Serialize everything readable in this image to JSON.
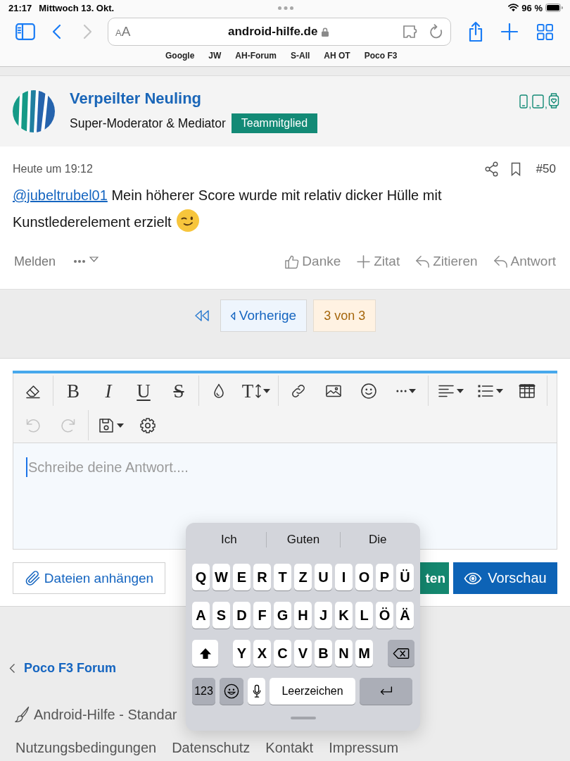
{
  "status_bar": {
    "time": "21:17",
    "date": "Mittwoch 13. Okt.",
    "battery": "96 %"
  },
  "browser": {
    "nav": [
      {
        "kind": "back",
        "disabled": false
      },
      {
        "kind": "forward",
        "disabled": true
      }
    ],
    "text_size": [
      "A",
      "A"
    ],
    "url": "android-hilfe.de",
    "bookmarks": [
      "Google",
      "JW",
      "AH-Forum",
      "S-All",
      "AH OT",
      "Poco F3"
    ]
  },
  "user": {
    "name": "Verpeilter Neuling",
    "role": "Super-Moderator & Mediator",
    "badge": "Teammitglied",
    "devices": [
      {
        "kind": "phone",
        "separator": ","
      },
      {
        "kind": "tablet",
        "separator": ","
      },
      {
        "kind": "watch"
      }
    ]
  },
  "post": {
    "time": "Heute um 19:12",
    "number": "#50",
    "mention": "@jubeltrubel01",
    "message": "Mein höherer Score wurde mit relativ dicker Hülle mit Kunstlederelement erzielt",
    "report": "Melden",
    "actions": [
      {
        "kind": "like",
        "label": "Danke"
      },
      {
        "kind": "add",
        "label": "Zitat"
      },
      {
        "kind": "reply",
        "label": "Zitieren"
      },
      {
        "kind": "reply",
        "label": "Antwort"
      }
    ]
  },
  "pagination": {
    "previous": "Vorherige",
    "current": "3 von 3"
  },
  "editor": {
    "toolbar": [
      [
        [
          {
            "kind": "eraser",
            "dropdown": false,
            "disabled": false
          }
        ],
        [
          {
            "kind": "bold",
            "glyph": "B",
            "dropdown": false,
            "disabled": false
          },
          {
            "kind": "italic",
            "glyph": "I",
            "dropdown": false,
            "disabled": false
          },
          {
            "kind": "underline",
            "glyph": "U",
            "dropdown": false,
            "disabled": false
          },
          {
            "kind": "strike",
            "glyph": "S",
            "dropdown": false,
            "disabled": false
          }
        ],
        [
          {
            "kind": "color",
            "dropdown": false,
            "disabled": false
          },
          {
            "kind": "size",
            "glyph": "T",
            "dropdown": true,
            "disabled": false
          }
        ],
        [
          {
            "kind": "link",
            "dropdown": false,
            "disabled": false
          },
          {
            "kind": "image",
            "dropdown": false,
            "disabled": false
          },
          {
            "kind": "smiley",
            "dropdown": false,
            "disabled": false
          },
          {
            "kind": "more",
            "dropdown": true,
            "disabled": false
          }
        ],
        [
          {
            "kind": "align",
            "dropdown": true,
            "disabled": false
          },
          {
            "kind": "list",
            "dropdown": true,
            "disabled": false
          },
          {
            "kind": "table",
            "dropdown": false,
            "disabled": false
          }
        ]
      ],
      [
        [
          {
            "kind": "undo",
            "dropdown": false,
            "disabled": true
          },
          {
            "kind": "redo",
            "dropdown": false,
            "disabled": true
          }
        ],
        [
          {
            "kind": "save",
            "dropdown": true,
            "disabled": false
          },
          {
            "kind": "settings",
            "dropdown": false,
            "disabled": false
          }
        ]
      ]
    ],
    "placeholder": "Schreibe deine Antwort....",
    "buttons": [
      {
        "kind": "attach",
        "label": "Dateien anhängen"
      },
      {
        "kind": "submit",
        "label": "ten"
      },
      {
        "kind": "preview",
        "label": "Vorschau"
      }
    ]
  },
  "footer": {
    "breadcrumb": "Poco F3 Forum",
    "style_chooser": "Android-Hilfe - Standar",
    "links": [
      "Nutzungsbedingungen",
      "Datenschutz",
      "Kontakt",
      "Impressum"
    ]
  },
  "keyboard": {
    "suggestions": [
      "Ich",
      "Guten",
      "Die"
    ],
    "rows": [
      [
        "Q",
        "W",
        "E",
        "R",
        "T",
        "Z",
        "U",
        "I",
        "O",
        "P",
        "Ü"
      ],
      [
        "A",
        "S",
        "D",
        "F",
        "G",
        "H",
        "J",
        "K",
        "L",
        "Ö",
        "Ä"
      ]
    ],
    "third_row": [
      "Y",
      "X",
      "C",
      "V",
      "B",
      "N",
      "M"
    ],
    "numbers_key": "123",
    "space_key": "Leerzeichen"
  }
}
